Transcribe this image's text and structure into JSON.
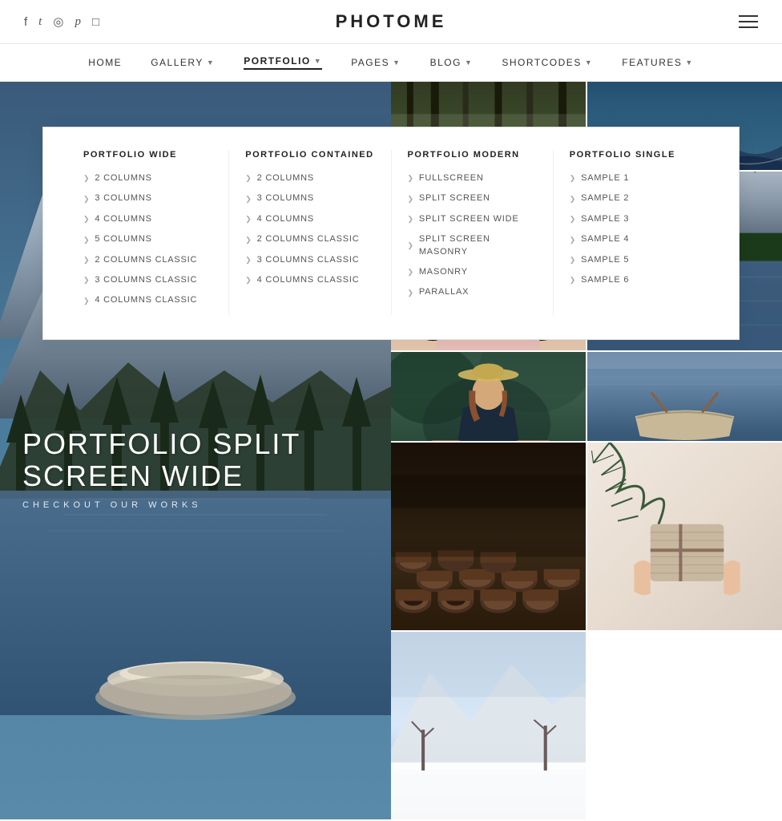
{
  "site": {
    "logo": "PHOTOME"
  },
  "social": {
    "icons": [
      {
        "name": "facebook-icon",
        "symbol": "f"
      },
      {
        "name": "twitter-icon",
        "symbol": "t"
      },
      {
        "name": "flickr-icon",
        "symbol": "◉"
      },
      {
        "name": "pinterest-icon",
        "symbol": "p"
      },
      {
        "name": "instagram-icon",
        "symbol": "◻"
      }
    ]
  },
  "nav": {
    "items": [
      {
        "label": "HOME",
        "active": false,
        "has_dropdown": false
      },
      {
        "label": "GALLERY",
        "active": false,
        "has_dropdown": true
      },
      {
        "label": "PORTFOLIO",
        "active": true,
        "has_dropdown": true
      },
      {
        "label": "PAGES",
        "active": false,
        "has_dropdown": true
      },
      {
        "label": "BLOG",
        "active": false,
        "has_dropdown": true
      },
      {
        "label": "SHORTCODES",
        "active": false,
        "has_dropdown": true
      },
      {
        "label": "FEATURES",
        "active": false,
        "has_dropdown": true
      }
    ]
  },
  "dropdown": {
    "cols": [
      {
        "title": "PORTFOLIO WIDE",
        "items": [
          "2 COLUMNS",
          "3 COLUMNS",
          "4 COLUMNS",
          "5 COLUMNS",
          "2 COLUMNS CLASSIC",
          "3 COLUMNS CLASSIC",
          "4 COLUMNS CLASSIC"
        ]
      },
      {
        "title": "PORTFOLIO CONTAINED",
        "items": [
          "2 COLUMNS",
          "3 COLUMNS",
          "4 COLUMNS",
          "2 COLUMNS CLASSIC",
          "3 COLUMNS CLASSIC",
          "4 COLUMNS CLASSIC"
        ]
      },
      {
        "title": "PORTFOLIO MODERN",
        "items": [
          "FULLSCREEN",
          "SPLIT SCREEN",
          "SPLIT SCREEN WIDE",
          "SPLIT SCREEN MASONRY",
          "MASONRY",
          "PARALLAX"
        ]
      },
      {
        "title": "PORTFOLIO SINGLE",
        "items": [
          "SAMPLE 1",
          "SAMPLE 2",
          "SAMPLE 3",
          "SAMPLE 4",
          "SAMPLE 5",
          "SAMPLE 6"
        ]
      }
    ]
  },
  "hero": {
    "title": "PORTFOLIO SPLIT SCREEN WIDE",
    "subtitle": "CHECKOUT OUR WORKS"
  }
}
